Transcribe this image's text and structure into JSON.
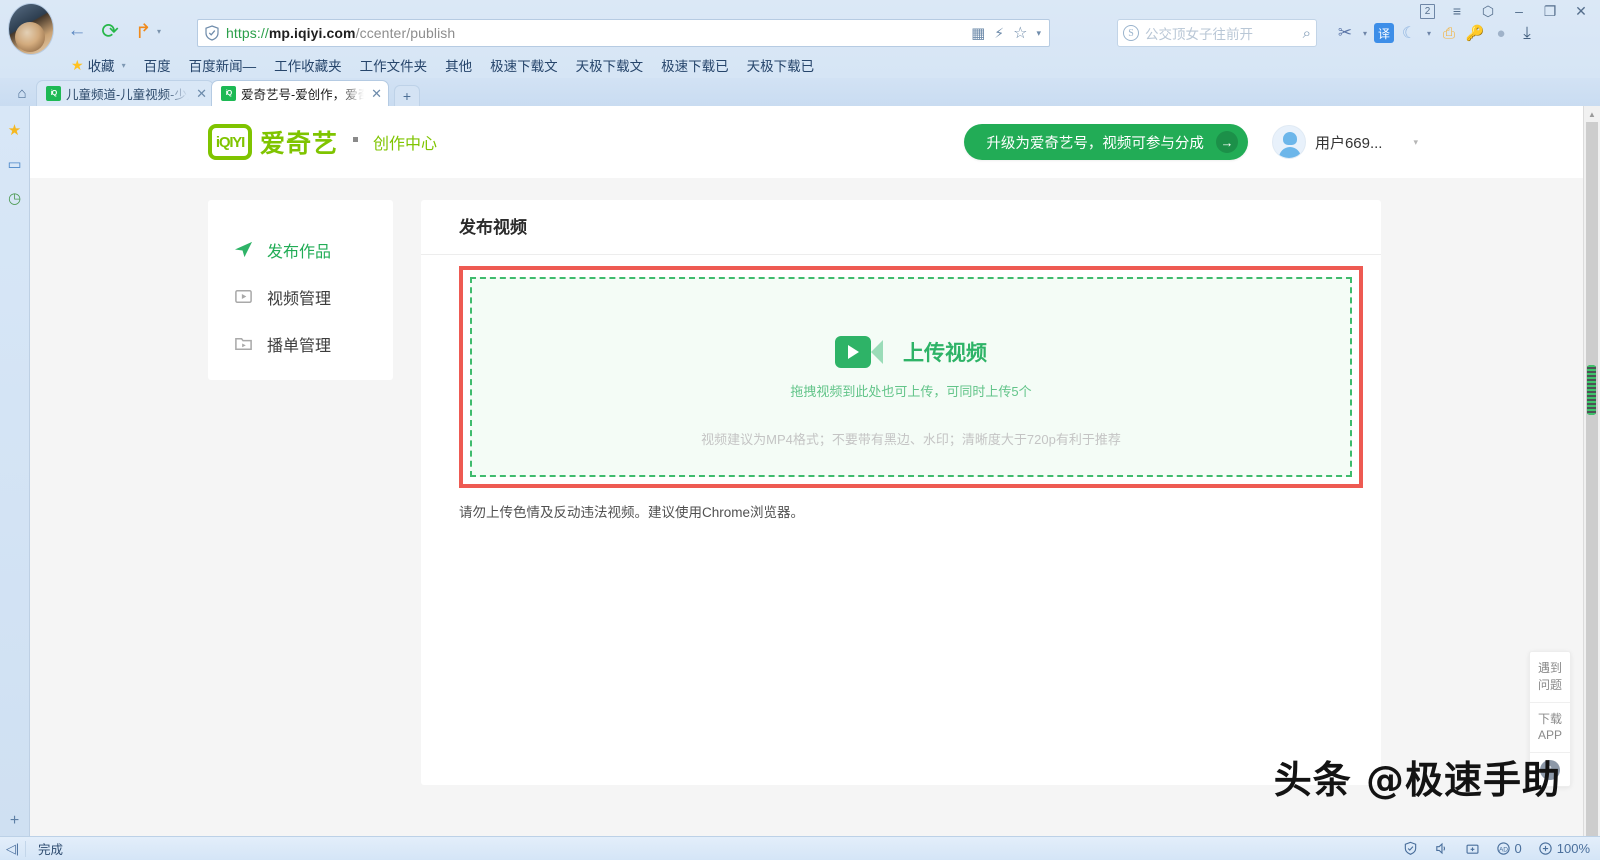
{
  "browser": {
    "url": {
      "scheme": "https://",
      "host": "mp.iqiyi.com",
      "path": "/ccenter/publish"
    },
    "nav": {
      "back": "←",
      "reload": "⟳",
      "forward": "↱"
    },
    "url_icons": {
      "qr": "▦",
      "lightning": "⚡",
      "star": "☆",
      "caret": "▾"
    },
    "search": {
      "placeholder": "公交顶女子往前开",
      "engine_icon": "S",
      "mag_icon": "⌕"
    },
    "extensions": [
      "✂",
      "▾",
      "译",
      "☾",
      "▾",
      "⊕",
      "🔑",
      "•••",
      "⤓"
    ],
    "window_controls": {
      "badge": "2",
      "menu": "≡",
      "shirt": "⬡",
      "minimize": "–",
      "maximize": "❐",
      "close": "✕"
    },
    "bookmarks": [
      "收藏",
      "百度",
      "百度新闻—",
      "工作收藏夹",
      "工作文件夹",
      "其他",
      "极速下载文",
      "天极下载文",
      "极速下载已",
      "天极下载已"
    ],
    "bookmarks_caret": "▾",
    "tabs": [
      {
        "title": "儿童频道-儿童视频-少儿",
        "active": false,
        "close": "✕",
        "favicon": "iQ"
      },
      {
        "title": "爱奇艺号-爱创作，爱奇艺",
        "active": true,
        "close": "✕",
        "favicon": "iQ"
      }
    ],
    "new_tab": "+",
    "home_icon": "⌂",
    "rail_icons": [
      "★",
      "▭",
      "◷"
    ],
    "rail_plus": "+",
    "statusbar": {
      "toggle": "◁|",
      "text": "完成",
      "right_items": [
        "0",
        "100%"
      ],
      "icons": [
        "shield",
        "speaker",
        "toolbox",
        "adblock",
        "zoom"
      ]
    }
  },
  "page": {
    "header": {
      "logo_text": "iQIYI",
      "brand": "爱奇艺",
      "subtitle": "创作中心",
      "upgrade_label": "升级为爱奇艺号，视频可参与分成",
      "upgrade_arrow": "→",
      "username": "用户669...",
      "user_caret": "▾"
    },
    "sidebar": {
      "items": [
        {
          "label": "发布作品",
          "icon": "send-icon",
          "active": true
        },
        {
          "label": "视频管理",
          "icon": "video-icon",
          "active": false
        },
        {
          "label": "播单管理",
          "icon": "folder-icon",
          "active": false
        }
      ]
    },
    "main": {
      "title": "发布视频",
      "upload_title": "上传视频",
      "upload_sub": "拖拽视频到此处也可上传，可同时上传5个",
      "upload_hint": "视频建议为MP4格式；不要带有黑边、水印；清晰度大于720p有利于推荐",
      "warning": "请勿上传色情及反动违法视频。建议使用Chrome浏览器。"
    },
    "float_panel": {
      "help_line1": "遇到",
      "help_line2": "问题",
      "app_line1": "下载",
      "app_line2": "APP",
      "back_to_top": "↑"
    },
    "watermark": "头条 @极速手助"
  },
  "colors": {
    "brand_green": "#7fc400",
    "accent_green": "#22ac56",
    "highlight_red": "#ee5a52",
    "dashed_green": "#3fbb6d"
  }
}
